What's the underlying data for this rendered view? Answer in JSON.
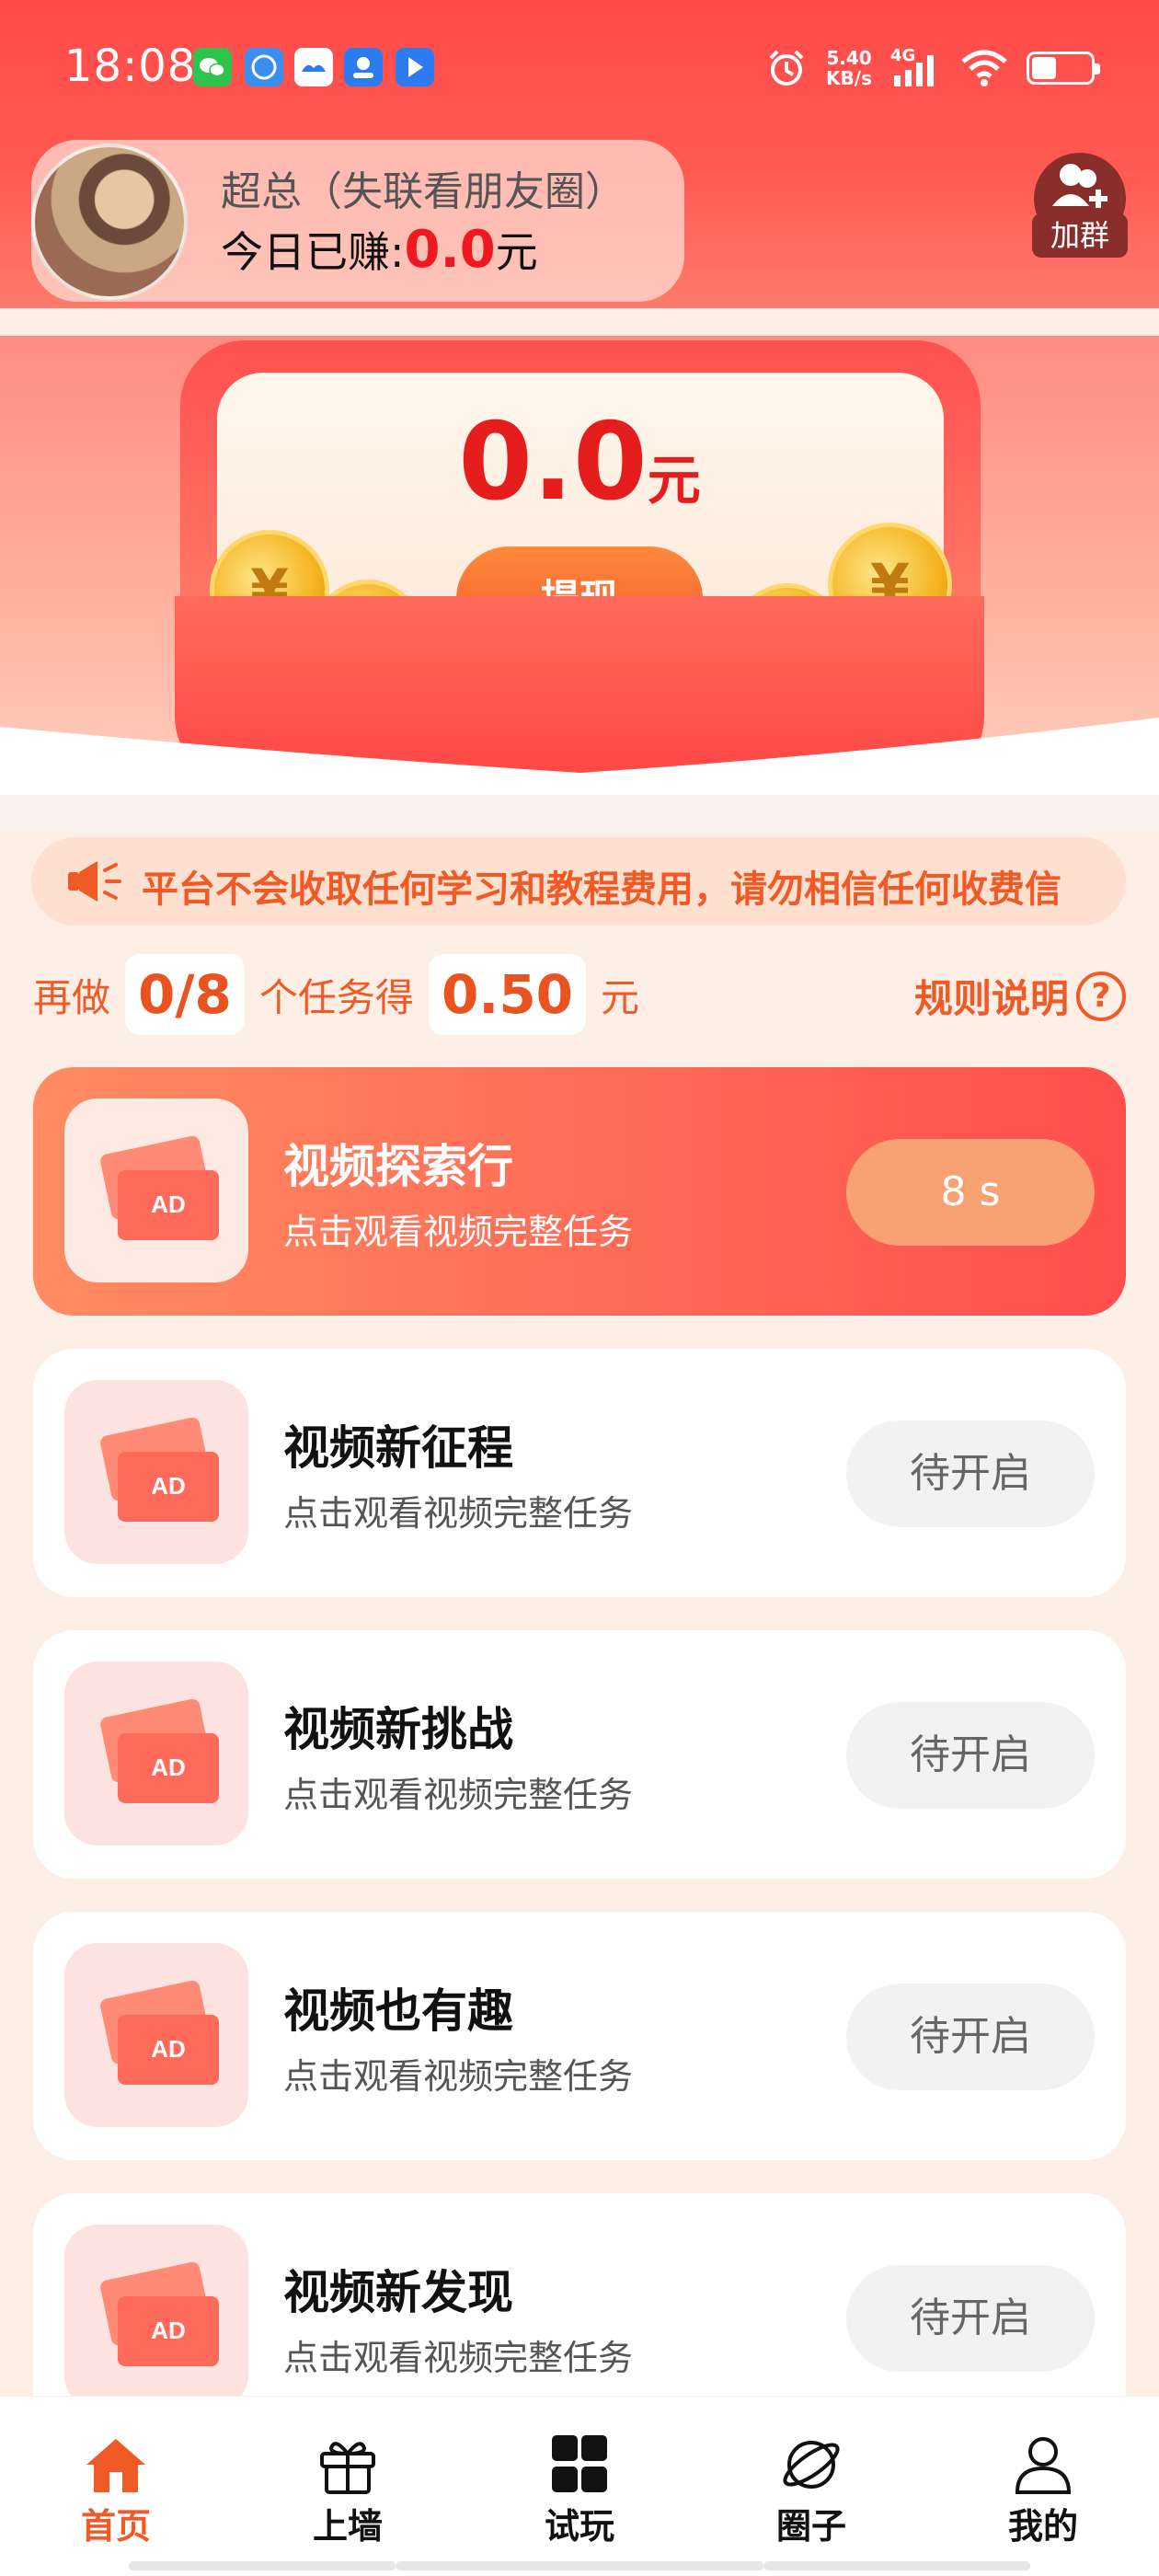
{
  "status": {
    "time": "18:08",
    "speed_value": "5.40",
    "speed_unit": "KB/s",
    "network": "4G",
    "app_icons": [
      "wechat-icon",
      "mail-icon",
      "cloud-icon",
      "id-icon",
      "arrow-app-icon"
    ]
  },
  "user": {
    "name": "超总（失联看朋友圈）",
    "earned_label": "今日已赚:",
    "earned_value": "0.0",
    "earned_unit": "元",
    "join_group_label": "加群"
  },
  "wallet": {
    "balance": "0.0",
    "unit": "元",
    "withdraw_label": "提现"
  },
  "notice": {
    "text": "平台不会收取任何学习和教程费用，请勿相信任何收费信"
  },
  "progress": {
    "prefix": "再做",
    "count": "0/8",
    "middle": "个任务得",
    "reward": "0.50",
    "unit": "元",
    "rules_label": "规则说明",
    "rules_icon": "?"
  },
  "tasks": [
    {
      "title": "视频探索行",
      "subtitle": "点击观看视频完整任务",
      "button": "8 s",
      "active": true
    },
    {
      "title": "视频新征程",
      "subtitle": "点击观看视频完整任务",
      "button": "待开启",
      "active": false
    },
    {
      "title": "视频新挑战",
      "subtitle": "点击观看视频完整任务",
      "button": "待开启",
      "active": false
    },
    {
      "title": "视频也有趣",
      "subtitle": "点击观看视频完整任务",
      "button": "待开启",
      "active": false
    },
    {
      "title": "视频新发现",
      "subtitle": "点击观看视频完整任务",
      "button": "待开启",
      "active": false
    }
  ],
  "ad_label": "AD",
  "nav": [
    {
      "label": "首页",
      "icon": "home-icon",
      "active": true
    },
    {
      "label": "上墙",
      "icon": "gift-icon",
      "active": false
    },
    {
      "label": "试玩",
      "icon": "grid-icon",
      "active": false
    },
    {
      "label": "圈子",
      "icon": "planet-icon",
      "active": false
    },
    {
      "label": "我的",
      "icon": "person-icon",
      "active": false
    }
  ],
  "colors": {
    "header_red": "#ff4a4a",
    "accent_orange": "#f05a26",
    "money_red": "#e61d1d",
    "active_task_start": "#ff8c62",
    "active_task_end": "#ff4e4e"
  }
}
